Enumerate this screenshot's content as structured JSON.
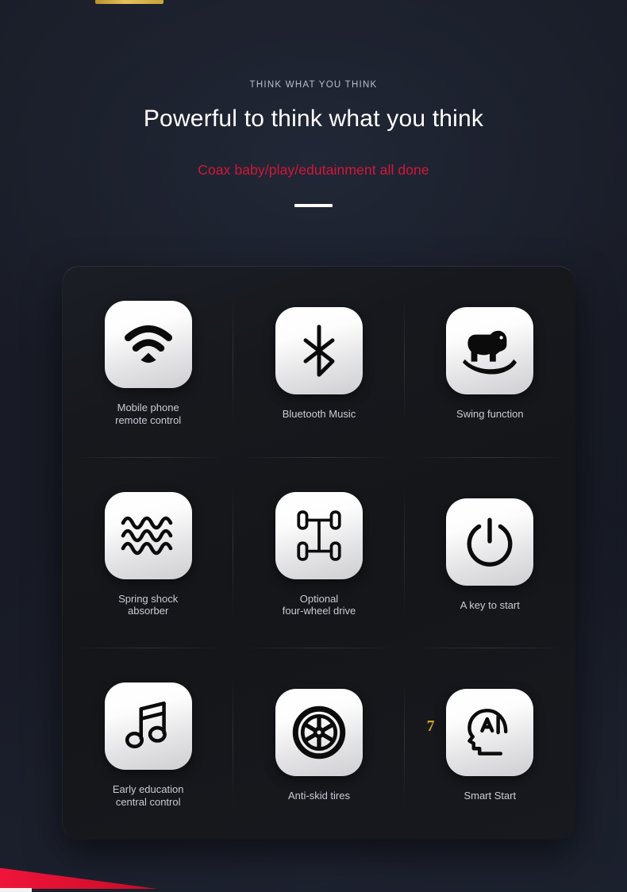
{
  "decor": {
    "gold_accent": "#c9a23d",
    "red_wedge": "#e0102f",
    "white_strip": "#f2f2f2"
  },
  "header": {
    "eyebrow": "THINK WHAT YOU THINK",
    "headline": "Powerful to think what you think",
    "subline": "Coax baby/play/edutainment all done",
    "subline_color": "#d3173a",
    "divider": true
  },
  "features": {
    "badge": "7",
    "badge_color": "#c9a227",
    "items": [
      {
        "icon": "wifi-icon",
        "label": "Mobile phone\nremote control"
      },
      {
        "icon": "bluetooth-icon",
        "label": "Bluetooth Music"
      },
      {
        "icon": "rocking-horse-icon",
        "label": "Swing function"
      },
      {
        "icon": "spring-wave-icon",
        "label": "Spring shock\nabsorber"
      },
      {
        "icon": "four-wheel-drive-icon",
        "label": "Optional\nfour-wheel drive"
      },
      {
        "icon": "power-button-icon",
        "label": "A key to start"
      },
      {
        "icon": "music-note-icon",
        "label": "Early education\ncentral control"
      },
      {
        "icon": "tire-wheel-icon",
        "label": "Anti-skid tires"
      },
      {
        "icon": "ai-head-icon",
        "label": "Smart Start"
      }
    ]
  }
}
